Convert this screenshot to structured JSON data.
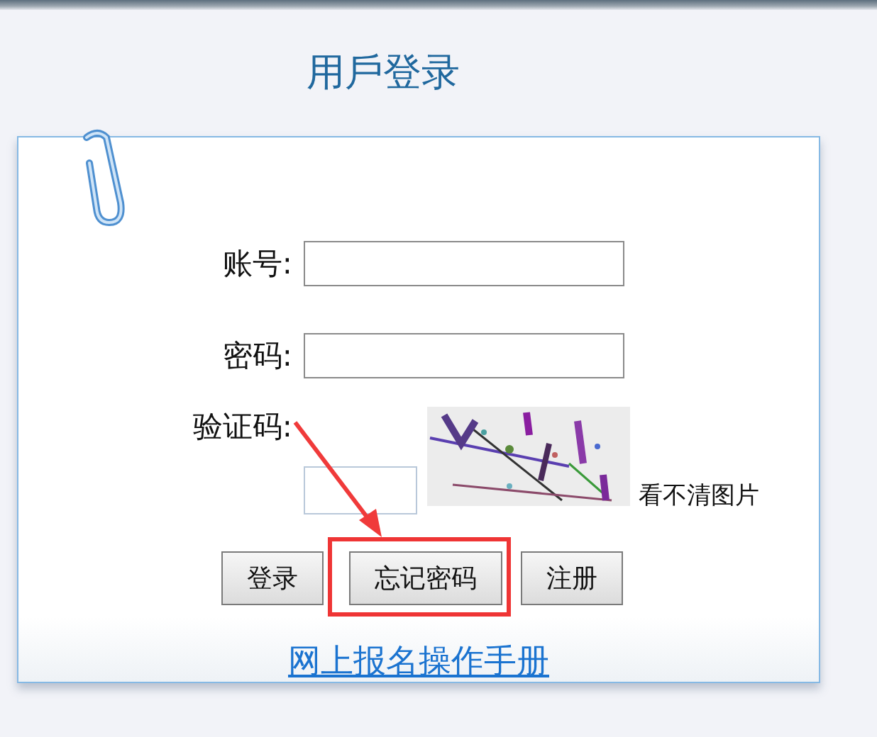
{
  "title": "用戶登录",
  "fields": [
    {
      "label": "账号:"
    },
    {
      "label": "密码:"
    }
  ],
  "captcha": {
    "label": "验证码:",
    "refresh_link": "看不清图片"
  },
  "buttons": [
    {
      "label": "登录",
      "highlighted": false
    },
    {
      "label": "忘记密码",
      "highlighted": true
    },
    {
      "label": "注册",
      "highlighted": false
    }
  ],
  "manual_link": "网上报名操作手册"
}
